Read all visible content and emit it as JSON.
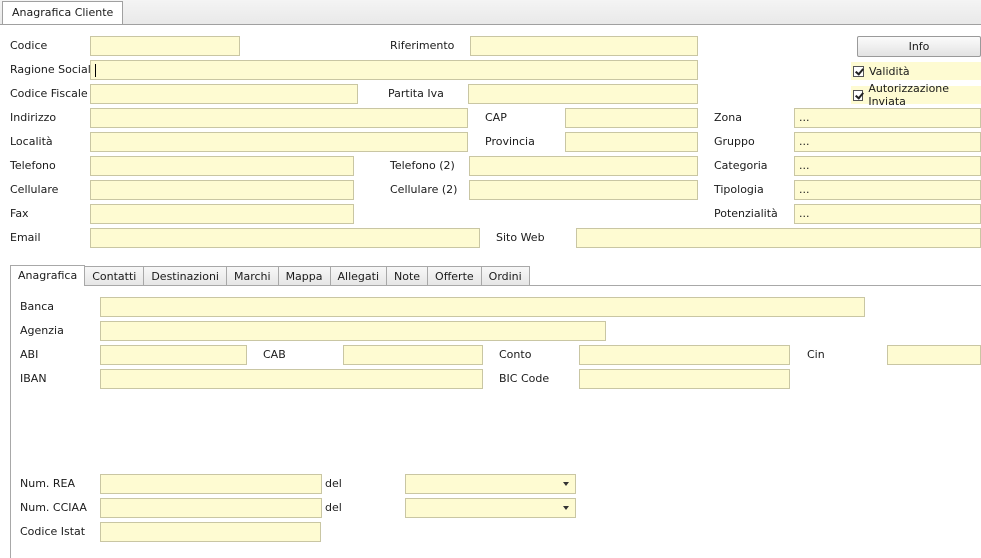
{
  "window": {
    "tab_label": "Anagrafica Cliente"
  },
  "header": {
    "codice": {
      "label": "Codice",
      "value": ""
    },
    "riferimento": {
      "label": "Riferimento",
      "value": ""
    },
    "ragione_sociale": {
      "label": "Ragione Sociale",
      "value": ""
    },
    "codice_fiscale": {
      "label": "Codice Fiscale",
      "value": ""
    },
    "partita_iva": {
      "label": "Partita Iva",
      "value": ""
    },
    "indirizzo": {
      "label": "Indirizzo",
      "value": ""
    },
    "cap": {
      "label": "CAP",
      "value": ""
    },
    "zona": {
      "label": "Zona",
      "value": "..."
    },
    "localita": {
      "label": "Località",
      "value": ""
    },
    "provincia": {
      "label": "Provincia",
      "value": ""
    },
    "gruppo": {
      "label": "Gruppo",
      "value": "..."
    },
    "telefono": {
      "label": "Telefono",
      "value": ""
    },
    "telefono2": {
      "label": "Telefono (2)",
      "value": ""
    },
    "categoria": {
      "label": "Categoria",
      "value": "..."
    },
    "cellulare": {
      "label": "Cellulare",
      "value": ""
    },
    "cellulare2": {
      "label": "Cellulare (2)",
      "value": ""
    },
    "tipologia": {
      "label": "Tipologia",
      "value": "..."
    },
    "fax": {
      "label": "Fax",
      "value": ""
    },
    "potenzialita": {
      "label": "Potenzialità",
      "value": "..."
    },
    "email": {
      "label": "Email",
      "value": ""
    },
    "sito_web": {
      "label": "Sito Web",
      "value": ""
    },
    "info_button": "Info",
    "validita": {
      "label": "Validità",
      "checked": true
    },
    "autorizzazione": {
      "label": "Autorizzazione Inviata",
      "checked": true
    }
  },
  "tabs": [
    {
      "label": "Anagrafica",
      "active": true
    },
    {
      "label": "Contatti"
    },
    {
      "label": "Destinazioni"
    },
    {
      "label": "Marchi"
    },
    {
      "label": "Mappa"
    },
    {
      "label": "Allegati"
    },
    {
      "label": "Note"
    },
    {
      "label": "Offerte"
    },
    {
      "label": "Ordini"
    }
  ],
  "anagrafica": {
    "banca": {
      "label": "Banca",
      "value": ""
    },
    "agenzia": {
      "label": "Agenzia",
      "value": ""
    },
    "abi": {
      "label": "ABI",
      "value": ""
    },
    "cab": {
      "label": "CAB",
      "value": ""
    },
    "conto": {
      "label": "Conto",
      "value": ""
    },
    "cin": {
      "label": "Cin",
      "value": ""
    },
    "iban": {
      "label": "IBAN",
      "value": ""
    },
    "bic": {
      "label": "BIC Code",
      "value": ""
    },
    "num_rea": {
      "label": "Num. REA",
      "value": "",
      "del_label": "del",
      "del_value": ""
    },
    "num_cciaa": {
      "label": "Num. CCIAA",
      "value": "",
      "del_label": "del",
      "del_value": ""
    },
    "codice_istat": {
      "label": "Codice Istat",
      "value": ""
    }
  },
  "colors": {
    "field_bg": "#fefbd2",
    "field_border": "#c9c6a3",
    "tab_border": "#a8a8a8"
  }
}
